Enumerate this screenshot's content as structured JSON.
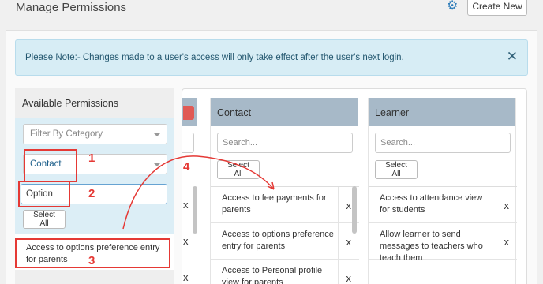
{
  "header": {
    "title": "Manage Permissions",
    "settings_icon": "gear-icon",
    "create_label": "Create New"
  },
  "notice": {
    "text": "Please Note:- Changes made to a user's access will only take effect after the user's next login.",
    "close_glyph": "✕"
  },
  "available": {
    "title": "Available Permissions",
    "filter_placeholder": "Filter By Category",
    "filter_value": "Contact",
    "option_value": "Option",
    "select_all_label": "Select All",
    "items": [
      {
        "label": "Access to options preference entry for parents"
      }
    ]
  },
  "columns": [
    {
      "header": "Contact",
      "search_placeholder": "Search...",
      "select_all_label": "Select All",
      "items": [
        {
          "label": "Access to fee payments for parents",
          "remove": "x"
        },
        {
          "label": "Access to options preference entry for parents",
          "remove": "x"
        },
        {
          "label": "Access to Personal profile view for parents",
          "remove": "x"
        }
      ]
    },
    {
      "header": "Learner",
      "search_placeholder": "Search...",
      "select_all_label": "Select All",
      "items": [
        {
          "label": "Access to attendance view for students",
          "remove": "x"
        },
        {
          "label": "Allow learner to send messages to teachers who teach them",
          "remove": "x"
        }
      ]
    }
  ],
  "partial_column": {
    "remove_marks": [
      "x",
      "x",
      "x"
    ]
  },
  "callouts": [
    "1",
    "2",
    "3",
    "4"
  ],
  "colors": {
    "accent": "#2a7ab8",
    "callout": "#e53935",
    "column_header": "#a7b9c8",
    "notice_bg": "#d7edf5"
  }
}
